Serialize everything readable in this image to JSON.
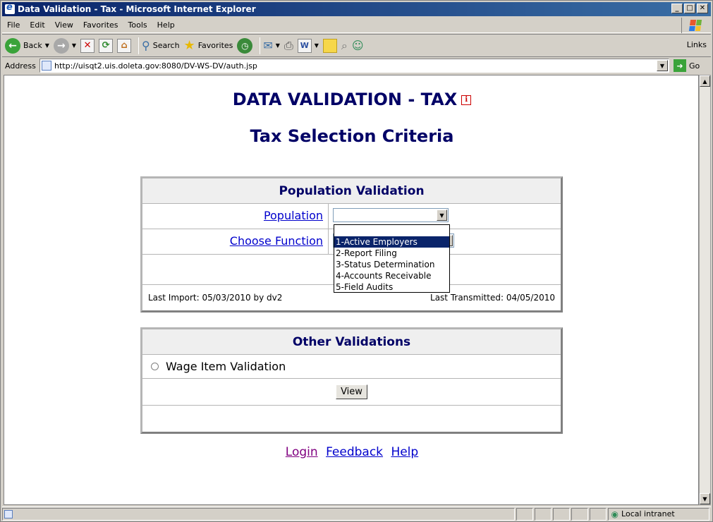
{
  "window": {
    "title": "Data Validation - Tax - Microsoft Internet Explorer"
  },
  "menu": [
    {
      "label": "File"
    },
    {
      "label": "Edit"
    },
    {
      "label": "View"
    },
    {
      "label": "Favorites"
    },
    {
      "label": "Tools"
    },
    {
      "label": "Help"
    }
  ],
  "toolbar": {
    "back_label": "Back",
    "search_label": "Search",
    "favorites_label": "Favorites",
    "links_label": "Links"
  },
  "address": {
    "label": "Address",
    "url": "http://uisqt2.uis.doleta.gov:8080/DV-WS-DV/auth.jsp",
    "go_label": "Go"
  },
  "page": {
    "title": "DATA VALIDATION - TAX",
    "subtitle": "Tax Selection Criteria",
    "population_panel": {
      "header": "Population Validation",
      "population_label": "Population",
      "function_label": "Choose Function",
      "dropdown_options": [
        "1-Active Employers",
        "2-Report Filing",
        "3-Status Determination",
        "4-Accounts Receivable",
        "5-Field Audits"
      ],
      "last_import": "Last Import: 05/03/2010 by dv2",
      "last_transmitted": "Last Transmitted: 04/05/2010"
    },
    "other_panel": {
      "header": "Other Validations",
      "wage_label": "Wage Item Validation",
      "view_button": "View"
    },
    "footer_links": {
      "login": "Login",
      "feedback": "Feedback",
      "help": "Help"
    }
  },
  "status": {
    "zone": "Local intranet"
  }
}
